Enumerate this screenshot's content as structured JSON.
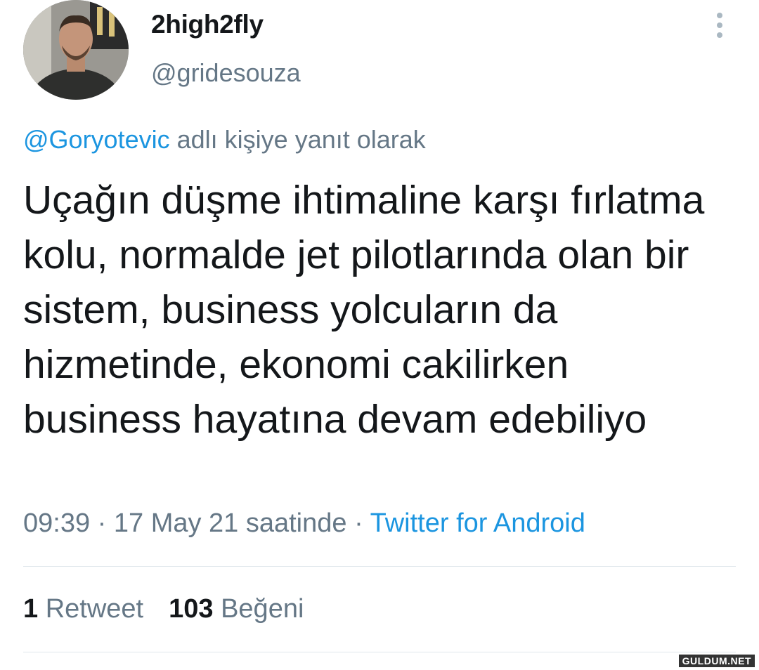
{
  "author": {
    "display_name": "2high2fly",
    "handle": "@gridesouza"
  },
  "reply": {
    "mention": "@Goryotevic",
    "suffix": "adlı kişiye yanıt olarak"
  },
  "tweet": {
    "text": "Uçağın düşme ihtimaline karşı fırlatma kolu, normalde jet pilotlarında olan bir sistem, business yolcuların da hizmetinde, ekonomi cakilirken business hayatına devam edebiliyo"
  },
  "meta": {
    "time_date": "09:39 · 17 May 21 saatinde",
    "separator": "·",
    "source": "Twitter for Android"
  },
  "stats": {
    "retweet_count": "1",
    "retweet_label": "Retweet",
    "like_count": "103",
    "like_label": "Beğeni"
  },
  "watermark": "GULDUM.NET",
  "icons": {
    "more": "more-vertical-icon"
  },
  "colors": {
    "link": "#1b95e0",
    "secondary_text": "#657786",
    "primary_text": "#14171a",
    "divider": "#e1e8ed"
  }
}
